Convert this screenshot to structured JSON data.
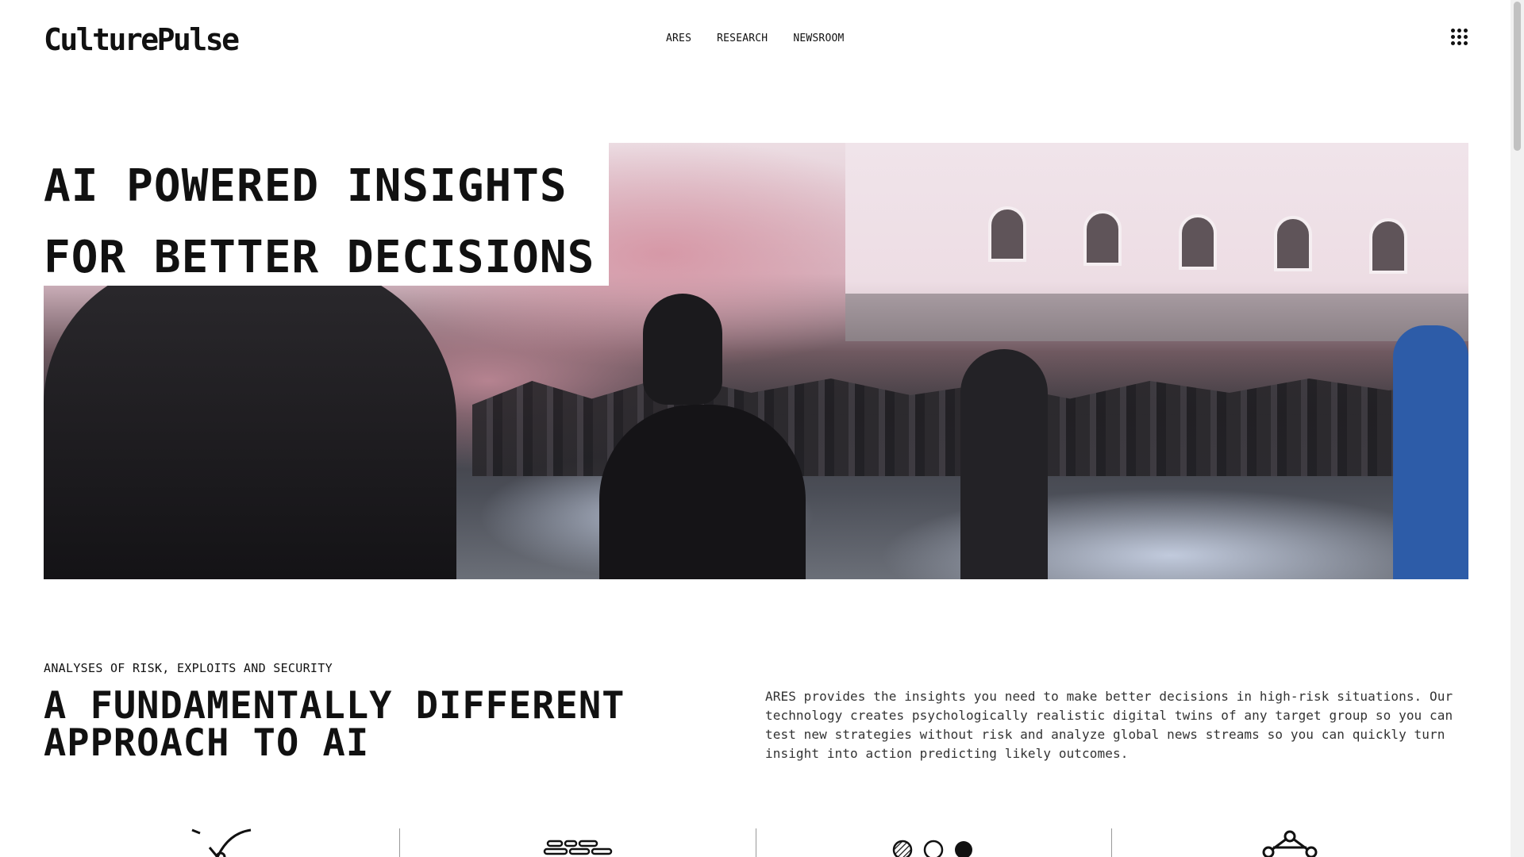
{
  "header": {
    "logo": "CulturePulse",
    "nav": [
      {
        "label": "ARES"
      },
      {
        "label": "RESEARCH"
      },
      {
        "label": "NEWSROOM"
      }
    ],
    "menu_icon": "grid-menu-icon"
  },
  "hero": {
    "title_line1": "AI POWERED INSIGHTS",
    "title_line2": "FOR BETTER DECISIONS",
    "image": "protest-crowd-smoke-photo"
  },
  "intro": {
    "eyebrow": "ANALYSES OF RISK, EXPLOITS AND SECURITY",
    "title_line1": "A FUNDAMENTALLY DIFFERENT",
    "title_line2": "APPROACH TO AI",
    "description": "ARES provides the insights you need to make better decisions in high-risk situations. Our technology creates psychologically realistic digital twins of any target group so you can test new strategies without risk and analyze global news streams so you can quickly turn insight into action predicting likely outcomes."
  },
  "features": {
    "icons": [
      "checkmark-sparkle-icon",
      "stacked-lines-icon",
      "three-circles-icon",
      "network-nodes-icon"
    ]
  },
  "colors": {
    "text": "#111111",
    "background": "#ffffff",
    "body_text": "#333333"
  }
}
